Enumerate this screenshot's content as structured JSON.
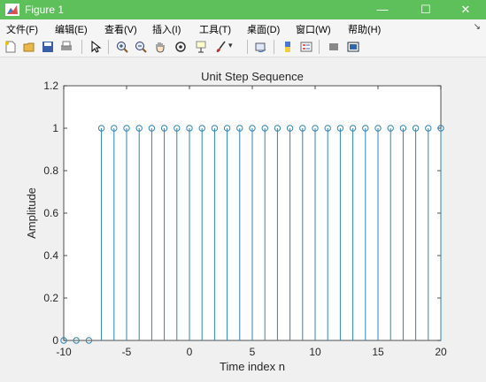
{
  "window": {
    "title": "Figure 1",
    "controls": {
      "minimize": "—",
      "maximize": "☐",
      "close": "✕"
    }
  },
  "menubar": {
    "items": [
      {
        "label": "文件(F)"
      },
      {
        "label": "编辑(E)"
      },
      {
        "label": "查看(V)"
      },
      {
        "label": "插入(I)"
      },
      {
        "label": "工具(T)"
      },
      {
        "label": "桌面(D)"
      },
      {
        "label": "窗口(W)"
      },
      {
        "label": "帮助(H)"
      }
    ]
  },
  "toolbar": {
    "buttons": [
      {
        "icon": "new-figure-icon"
      },
      {
        "icon": "open-file-icon"
      },
      {
        "icon": "save-icon"
      },
      {
        "icon": "print-icon"
      },
      {
        "icon": "pointer-icon"
      },
      {
        "icon": "zoom-in-icon"
      },
      {
        "icon": "zoom-out-icon"
      },
      {
        "icon": "pan-icon"
      },
      {
        "icon": "rotate-icon"
      },
      {
        "icon": "data-cursor-icon"
      },
      {
        "icon": "brush-icon"
      },
      {
        "icon": "link-plot-icon"
      },
      {
        "icon": "colorbar-icon"
      },
      {
        "icon": "legend-icon"
      },
      {
        "icon": "hide-plot-tools-icon"
      },
      {
        "icon": "show-plot-tools-icon"
      }
    ]
  },
  "colors": {
    "titlebar": "#5ec05a",
    "stem": "#2e84b8"
  },
  "chart_data": {
    "type": "stem",
    "title": "Unit Step Sequence",
    "xlabel": "Time index n",
    "ylabel": "Amplitude",
    "xlim": [
      -10,
      20
    ],
    "ylim": [
      0,
      1.2
    ],
    "xticks": [
      -10,
      -5,
      0,
      5,
      10,
      15,
      20
    ],
    "xtick_labels": [
      "-10",
      "-5",
      "0",
      "5",
      "10",
      "15",
      "20"
    ],
    "yticks": [
      0,
      0.2,
      0.4,
      0.6,
      0.8,
      1.0,
      1.2
    ],
    "ytick_labels": [
      "0",
      "0.2",
      "0.4",
      "0.6",
      "0.8",
      "1",
      "1.2"
    ],
    "x": [
      -10,
      -9,
      -8,
      -7,
      -6,
      -5,
      -4,
      -3,
      -2,
      -1,
      0,
      1,
      2,
      3,
      4,
      5,
      6,
      7,
      8,
      9,
      10,
      11,
      12,
      13,
      14,
      15,
      16,
      17,
      18,
      19,
      20
    ],
    "y": [
      0,
      0,
      0,
      1,
      1,
      1,
      1,
      1,
      1,
      1,
      1,
      1,
      1,
      1,
      1,
      1,
      1,
      1,
      1,
      1,
      1,
      1,
      1,
      1,
      1,
      1,
      1,
      1,
      1,
      1,
      1
    ],
    "marker": "circle-open",
    "grid": false
  }
}
